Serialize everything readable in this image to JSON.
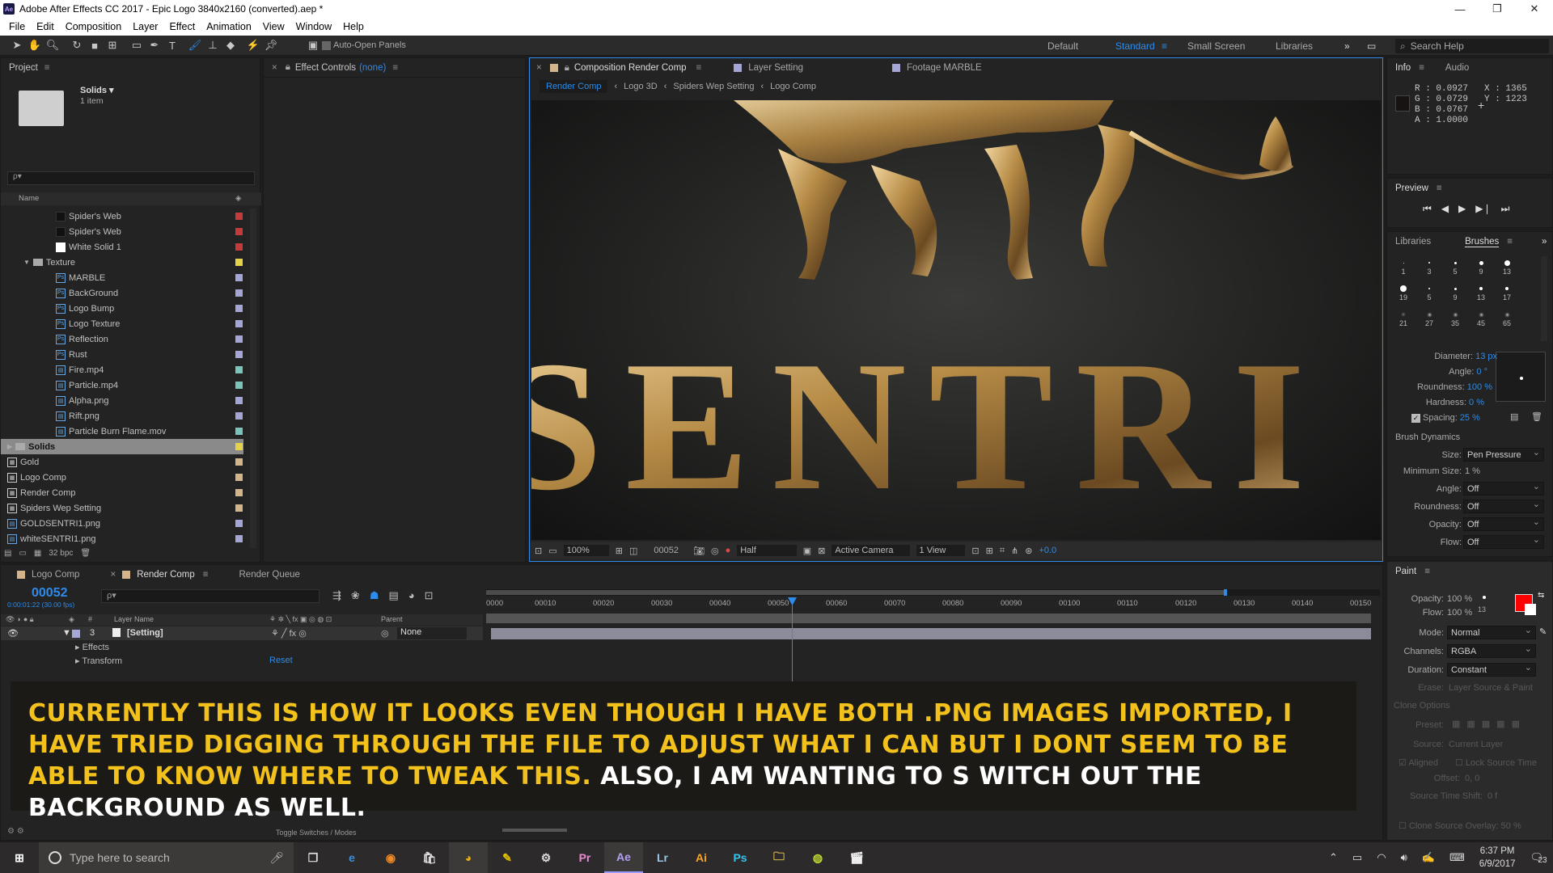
{
  "window": {
    "title": "Adobe After Effects CC 2017 - Epic Logo 3840x2160 (converted).aep *",
    "minimize": "—",
    "maximize": "❐",
    "close": "✕"
  },
  "menu": [
    "File",
    "Edit",
    "Composition",
    "Layer",
    "Effect",
    "Animation",
    "View",
    "Window",
    "Help"
  ],
  "toolbar": {
    "auto_open": "Auto-Open Panels",
    "workspaces": [
      "Default",
      "Standard",
      "Small Screen",
      "Libraries"
    ],
    "search_help": "Search Help"
  },
  "project": {
    "tab": "Project",
    "folder_name": "Solids ▾",
    "folder_count": "1 item",
    "search_placeholder": "ρ▾",
    "col_name": "Name",
    "rows": [
      {
        "label": "Spider's Web",
        "indent": 3,
        "icon": "solid-dark",
        "color": "#c43b3b"
      },
      {
        "label": "Spider's Web",
        "indent": 3,
        "icon": "solid-dark",
        "color": "#c43b3b"
      },
      {
        "label": "White Solid 1",
        "indent": 3,
        "icon": "solid-white",
        "color": "#c43b3b"
      },
      {
        "label": "Texture",
        "indent": 1,
        "icon": "folder",
        "color": "#e3d24a"
      },
      {
        "label": "MARBLE",
        "indent": 3,
        "icon": "psd",
        "color": "#a5a5d6"
      },
      {
        "label": "BackGround",
        "indent": 3,
        "icon": "psd",
        "color": "#a5a5d6"
      },
      {
        "label": "Logo Bump",
        "indent": 3,
        "icon": "psd",
        "color": "#a5a5d6"
      },
      {
        "label": "Logo Texture",
        "indent": 3,
        "icon": "psd",
        "color": "#a5a5d6"
      },
      {
        "label": "Reflection",
        "indent": 3,
        "icon": "psd",
        "color": "#a5a5d6"
      },
      {
        "label": "Rust",
        "indent": 3,
        "icon": "psd",
        "color": "#a5a5d6"
      },
      {
        "label": "Fire.mp4",
        "indent": 3,
        "icon": "file",
        "color": "#7cc3b9"
      },
      {
        "label": "Particle.mp4",
        "indent": 3,
        "icon": "file",
        "color": "#7cc3b9"
      },
      {
        "label": "Alpha.png",
        "indent": 3,
        "icon": "file",
        "color": "#a5a5d6"
      },
      {
        "label": "Rift.png",
        "indent": 3,
        "icon": "file",
        "color": "#a5a5d6"
      },
      {
        "label": "Particle Burn Flame.mov",
        "indent": 3,
        "icon": "file",
        "color": "#7cc3b9"
      },
      {
        "label": "Solids",
        "indent": 0,
        "icon": "folder",
        "color": "#e3d24a",
        "selected": true
      },
      {
        "label": "Gold",
        "indent": 0,
        "icon": "comp",
        "color": "#d4b48a"
      },
      {
        "label": "Logo Comp",
        "indent": 0,
        "icon": "comp",
        "color": "#d4b48a"
      },
      {
        "label": "Render Comp",
        "indent": 0,
        "icon": "comp",
        "color": "#d4b48a"
      },
      {
        "label": "Spiders Wep Setting",
        "indent": 0,
        "icon": "comp",
        "color": "#d4b48a"
      },
      {
        "label": "GOLDSENTRI1.png",
        "indent": 0,
        "icon": "file",
        "color": "#a5a5d6"
      },
      {
        "label": "whiteSENTRI1.png",
        "indent": 0,
        "icon": "file",
        "color": "#a5a5d6"
      }
    ],
    "bpc": "32 bpc"
  },
  "effect_controls": {
    "label": "Effect Controls",
    "value": "(none)"
  },
  "comp": {
    "tabs": [
      "Composition Render Comp",
      "Layer Setting",
      "Footage MARBLE"
    ],
    "breadcrumbs": [
      "Render Comp",
      "Logo 3D",
      "Spiders Wep Setting",
      "Logo Comp"
    ],
    "viewer_text": "ENTI",
    "zoom": "100%",
    "timecode": "00052",
    "resolution": "Half",
    "camera": "Active Camera",
    "views": "1 View",
    "exposure": "+0.0"
  },
  "info": {
    "tabs": [
      "Info",
      "Audio"
    ],
    "r": "R : 0.0927",
    "g": "G : 0.0729",
    "b": "B : 0.0767",
    "a": "A : 1.0000",
    "x": "X : 1365",
    "y": "Y : 1223"
  },
  "preview": {
    "title": "Preview"
  },
  "brushes": {
    "tabs": [
      "Libraries",
      "Brushes"
    ],
    "sizes": [
      "1",
      "3",
      "5",
      "9",
      "13",
      "19",
      "5",
      "9",
      "13",
      "17",
      "21",
      "27",
      "35",
      "45",
      "65"
    ],
    "diameter_label": "Diameter:",
    "diameter": "13 px",
    "angle_label": "Angle:",
    "angle": "0 °",
    "roundness_label": "Roundness:",
    "roundness": "100 %",
    "hardness_label": "Hardness:",
    "hardness": "0 %",
    "spacing_label": "Spacing:",
    "spacing": "25 %",
    "dynamics": "Brush Dynamics",
    "size_label": "Size:",
    "size": "Pen Pressure",
    "min_size_label": "Minimum Size:",
    "min_size": "1 %",
    "d_angle_label": "Angle:",
    "d_angle": "Off",
    "d_round_label": "Roundness:",
    "d_round": "Off",
    "d_opacity_label": "Opacity:",
    "d_opacity": "Off",
    "d_flow_label": "Flow:",
    "d_flow": "Off"
  },
  "paint": {
    "title": "Paint",
    "opacity_label": "Opacity:",
    "opacity": "100 %",
    "flow_label": "Flow:",
    "flow": "100 %",
    "brush_size": "13",
    "mode_label": "Mode:",
    "mode": "Normal",
    "channels_label": "Channels:",
    "channels": "RGBA",
    "duration_label": "Duration:",
    "duration": "Constant",
    "erase_label": "Erase:",
    "erase": "Layer Source & Paint",
    "clone_options": "Clone Options",
    "preset_label": "Preset:",
    "source_label": "Source:",
    "source": "Current Layer",
    "aligned": "Aligned",
    "lock_source": "Lock Source Time",
    "offset_label": "Offset:",
    "offset": "0, 0",
    "time_shift_label": "Source Time Shift:",
    "time_shift": "0 f",
    "clone_overlay": "Clone Source Overlay:",
    "clone_overlay_val": "50 %",
    "fg_color": "#ff0000"
  },
  "timeline": {
    "tabs": [
      "Logo Comp",
      "Render Comp",
      "Render Queue"
    ],
    "timecode": "00052",
    "sub_timecode": "0:00:01:22 (30.00 fps)",
    "col_layer_name": "Layer Name",
    "col_parent": "Parent",
    "layer_num": "3",
    "layer_name": "[Setting]",
    "parent": "None",
    "effects": "Effects",
    "transform": "Transform",
    "reset": "Reset",
    "ruler": [
      "0000",
      "00010",
      "00020",
      "00030",
      "00040",
      "00050",
      "00060",
      "00070",
      "00080",
      "00090",
      "00100",
      "00110",
      "00120",
      "00130",
      "00140",
      "00150"
    ],
    "toggle": "Toggle Switches / Modes"
  },
  "caption": {
    "yellow": "Currently this is how it looks even though I have both .png images imported, I have tried digging through the file to adjust what I can but I dont seem to be able to know where to tweak this.",
    "white": " Also, I am wanting to s witch out the background as well.",
    "yellow_color": "#f2c11b"
  },
  "taskbar": {
    "search_placeholder": "Type here to search",
    "time": "6:37 PM",
    "date": "6/9/2017",
    "notifications": "23"
  }
}
